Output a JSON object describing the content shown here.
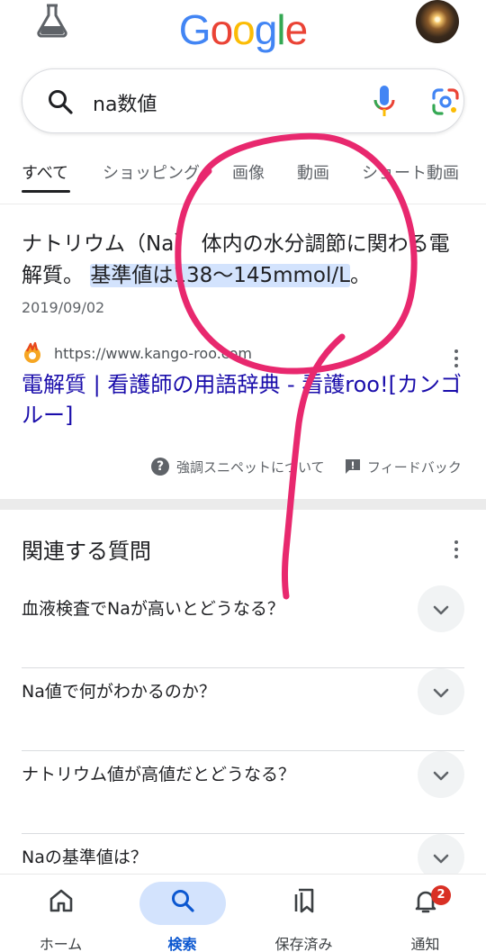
{
  "header": {
    "logo_letters": [
      "G",
      "o",
      "o",
      "g",
      "l",
      "e"
    ],
    "logo_colors": [
      "#4285F4",
      "#EA4335",
      "#FBBC05",
      "#4285F4",
      "#34A853",
      "#EA4335"
    ]
  },
  "search": {
    "query": "na数値"
  },
  "tabs": [
    {
      "label": "すべて",
      "active": true
    },
    {
      "label": "ショッピング",
      "active": false
    },
    {
      "label": "画像",
      "active": false
    },
    {
      "label": "動画",
      "active": false
    },
    {
      "label": "ショート動画",
      "active": false
    }
  ],
  "snippet": {
    "text_before": "ナトリウム（Na） 体内の水分調節に関わる電解質。",
    "text_highlight": "基準値は138～145mmol/L",
    "text_after": "。",
    "date": "2019/09/02"
  },
  "result": {
    "url": "https://www.kango-roo.com",
    "title": "電解質 | 看護師の用語辞典 - 看護roo![カンゴルー]"
  },
  "snippet_footer": {
    "about": "強調スニペットについて",
    "feedback": "フィードバック"
  },
  "paa": {
    "title": "関連する質問",
    "questions": [
      "血液検査でNaが高いとどうなる？",
      "Na値で何がわかるのか？",
      "ナトリウム値が高値だとどうなる？",
      "Naの基準値は？"
    ]
  },
  "bottom_nav": {
    "items": [
      {
        "label": "ホーム",
        "icon": "home-icon"
      },
      {
        "label": "検索",
        "icon": "search-icon",
        "active": true
      },
      {
        "label": "保存済み",
        "icon": "bookmarks-icon"
      },
      {
        "label": "通知",
        "icon": "bell-icon",
        "badge": "2"
      }
    ]
  },
  "colors": {
    "link": "#1a0dab",
    "highlight": "#d3e3fd",
    "annotation": "#e8286e",
    "accent": "#0b57d0"
  }
}
